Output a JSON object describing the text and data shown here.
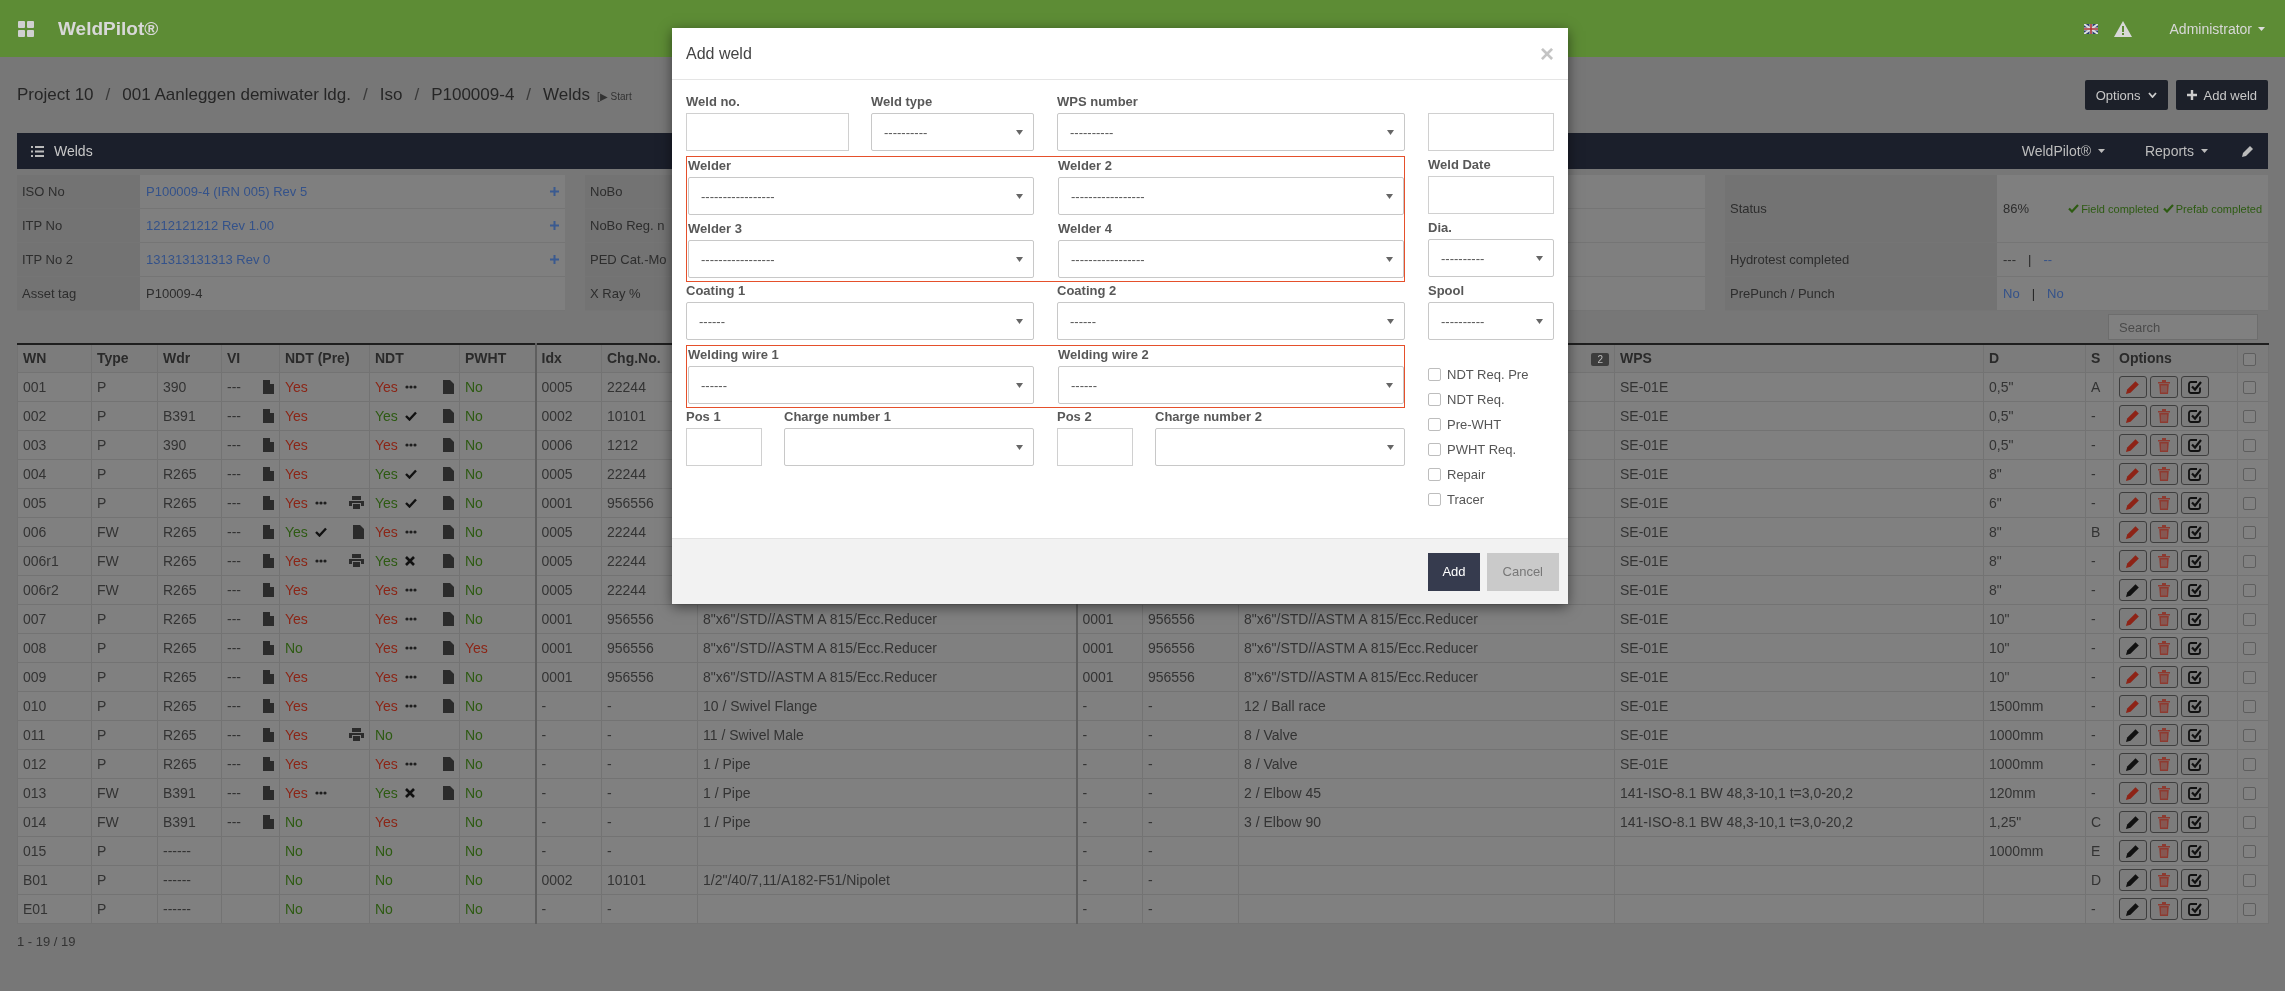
{
  "app": {
    "title": "WeldPilot®",
    "user": "Administrator"
  },
  "breadcrumb": [
    {
      "label": "Project 10"
    },
    {
      "separator": "/",
      "label": "001 Aanleggen demiwater ldg."
    },
    {
      "separator": "/",
      "label": "Iso"
    },
    {
      "separator": "/",
      "label": "P100009-4"
    },
    {
      "separator": "/",
      "label": "Welds"
    }
  ],
  "start_link": "[▶ Start",
  "header_buttons": [
    {
      "label": "Options",
      "kind": "dropdown"
    },
    {
      "label": "Add weld",
      "kind": "add"
    }
  ],
  "panel": {
    "title": "Welds",
    "menus": [
      "WeldPilot®",
      "Reports"
    ]
  },
  "info_left": [
    {
      "label": "ISO No",
      "value": "P100009-4 (IRN 005) Rev 5",
      "link": true,
      "addable": true
    },
    {
      "label": "ITP No",
      "value": "1212121212 Rev 1.00",
      "link": true,
      "addable": true
    },
    {
      "label": "ITP No 2",
      "value": "131313131313 Rev 0",
      "link": true,
      "addable": true
    },
    {
      "label": "Asset tag",
      "value": "P10009-4",
      "link": false,
      "addable": false
    }
  ],
  "info_middle": [
    {
      "label": "NoBo"
    },
    {
      "label": "NoBo Reg. n"
    },
    {
      "label": "PED Cat.-Mo"
    },
    {
      "label": "X Ray %"
    }
  ],
  "status": {
    "label": "Status",
    "value": "86%",
    "badges": [
      {
        "label": "Field completed"
      },
      {
        "label": "Prefab completed"
      }
    ]
  },
  "hydrotest": {
    "label": "Hydrotest completed",
    "value": "---",
    "separator": "|",
    "link": "--"
  },
  "punch": {
    "label": "PrePunch / Punch",
    "prepunch": "No",
    "separator": "|",
    "punch": "No"
  },
  "search": {
    "placeholder": "Search"
  },
  "table": {
    "columns": [
      "WN",
      "Type",
      "Wdr",
      "VI",
      "NDT (Pre)",
      "NDT",
      "PWHT",
      "Idx",
      "Chg.No.",
      "WPS",
      "D",
      "S",
      "Options"
    ],
    "badge": "2",
    "select_all": {
      "checked": false
    },
    "rows": [
      {
        "wn": "001",
        "type": "P",
        "wdr": "390",
        "vi": {
          "text": "---",
          "report": true
        },
        "ndt_pre": {
          "text": "Yes",
          "ok": false
        },
        "ndt": {
          "text": "Yes",
          "ok": false,
          "kind": "pending",
          "report": true
        },
        "pwht": {
          "text": "No",
          "ok": true
        },
        "idx": "0005",
        "chg": "22244",
        "wps": "SE-01E",
        "d": "0,5\"",
        "s": "A",
        "edit_flagged": true,
        "checked": false
      },
      {
        "wn": "002",
        "type": "P",
        "wdr": "B391",
        "vi": {
          "text": "---",
          "report": true
        },
        "ndt_pre": {
          "text": "Yes",
          "ok": false
        },
        "ndt": {
          "text": "Yes",
          "ok": true,
          "kind": "accepted",
          "report": true
        },
        "pwht": {
          "text": "No",
          "ok": true
        },
        "idx": "0002",
        "chg": "10101",
        "wps": "SE-01E",
        "d": "0,5\"",
        "s": "-",
        "edit_flagged": true,
        "checked": false
      },
      {
        "wn": "003",
        "type": "P",
        "wdr": "390",
        "vi": {
          "text": "---",
          "report": true
        },
        "ndt_pre": {
          "text": "Yes",
          "ok": false
        },
        "ndt": {
          "text": "Yes",
          "ok": false,
          "kind": "pending",
          "report": true
        },
        "pwht": {
          "text": "No",
          "ok": true
        },
        "idx": "0006",
        "chg": "1212",
        "wps": "SE-01E",
        "d": "0,5\"",
        "s": "-",
        "edit_flagged": true,
        "checked": false
      },
      {
        "wn": "004",
        "type": "P",
        "wdr": "R265",
        "vi": {
          "text": "---",
          "report": true
        },
        "ndt_pre": {
          "text": "Yes",
          "ok": false
        },
        "ndt": {
          "text": "Yes",
          "ok": true,
          "kind": "accepted",
          "report": true
        },
        "pwht": {
          "text": "No",
          "ok": true
        },
        "idx": "0005",
        "chg": "22244",
        "wps": "SE-01E",
        "d": "8\"",
        "s": "-",
        "edit_flagged": true,
        "checked": false
      },
      {
        "wn": "005",
        "type": "P",
        "wdr": "R265",
        "vi": {
          "text": "---",
          "report": true
        },
        "ndt_pre": {
          "text": "Yes",
          "ok": false,
          "kind": "pending",
          "printable": true
        },
        "ndt": {
          "text": "Yes",
          "ok": true,
          "kind": "accepted",
          "report": true
        },
        "pwht": {
          "text": "No",
          "ok": true
        },
        "idx": "0001",
        "chg": "956556",
        "wps": "SE-01E",
        "d": "6\"",
        "s": "-",
        "edit_flagged": true,
        "checked": false
      },
      {
        "wn": "006",
        "type": "FW",
        "wdr": "R265",
        "vi": {
          "text": "---",
          "report": true
        },
        "ndt_pre": {
          "text": "Yes",
          "ok": true,
          "kind": "accepted",
          "report": true
        },
        "ndt": {
          "text": "Yes",
          "ok": false,
          "kind": "pending",
          "report": true
        },
        "pwht": {
          "text": "No",
          "ok": true
        },
        "idx": "0005",
        "chg": "22244",
        "wps": "SE-01E",
        "d": "8\"",
        "s": "B",
        "edit_flagged": true,
        "checked": false
      },
      {
        "wn": "006r1",
        "type": "FW",
        "wdr": "R265",
        "vi": {
          "text": "---",
          "report": true
        },
        "ndt_pre": {
          "text": "Yes",
          "ok": false,
          "kind": "pending",
          "printable": true
        },
        "ndt": {
          "text": "Yes",
          "ok": true,
          "kind": "rejected",
          "report": true
        },
        "pwht": {
          "text": "No",
          "ok": true
        },
        "idx": "0005",
        "chg": "22244",
        "wps": "SE-01E",
        "d": "8\"",
        "s": "-",
        "edit_flagged": true,
        "checked": false
      },
      {
        "wn": "006r2",
        "type": "FW",
        "wdr": "R265",
        "vi": {
          "text": "---",
          "report": true
        },
        "ndt_pre": {
          "text": "Yes",
          "ok": false
        },
        "ndt": {
          "text": "Yes",
          "ok": false,
          "kind": "pending",
          "report": true
        },
        "pwht": {
          "text": "No",
          "ok": true
        },
        "idx": "0005",
        "chg": "22244",
        "wps": "SE-01E",
        "d": "8\"",
        "s": "-",
        "edit_flagged": false,
        "checked": false
      },
      {
        "wn": "007",
        "type": "P",
        "wdr": "R265",
        "vi": {
          "text": "---",
          "report": true
        },
        "ndt_pre": {
          "text": "Yes",
          "ok": false
        },
        "ndt": {
          "text": "Yes",
          "ok": false,
          "kind": "pending",
          "report": true
        },
        "pwht": {
          "text": "No",
          "ok": true
        },
        "idx": "0001",
        "chg": "956556",
        "desc": "8\"x6\"/STD//ASTM A 815/Ecc.Reducer",
        "idx2": "0001",
        "chg2": "956556",
        "desc2": "8\"x6\"/STD//ASTM A 815/Ecc.Reducer",
        "wps": "SE-01E",
        "d": "10\"",
        "s": "-",
        "edit_flagged": true,
        "checked": false
      },
      {
        "wn": "008",
        "type": "P",
        "wdr": "R265",
        "vi": {
          "text": "---",
          "report": true
        },
        "ndt_pre": {
          "text": "No",
          "ok": true
        },
        "ndt": {
          "text": "Yes",
          "ok": false,
          "kind": "pending",
          "report": true
        },
        "pwht": {
          "text": "Yes",
          "ok": false
        },
        "idx": "0001",
        "chg": "956556",
        "desc": "8\"x6\"/STD//ASTM A 815/Ecc.Reducer",
        "idx2": "0001",
        "chg2": "956556",
        "desc2": "8\"x6\"/STD//ASTM A 815/Ecc.Reducer",
        "wps": "SE-01E",
        "d": "10\"",
        "s": "-",
        "edit_flagged": false,
        "checked": false
      },
      {
        "wn": "009",
        "type": "P",
        "wdr": "R265",
        "vi": {
          "text": "---",
          "report": true
        },
        "ndt_pre": {
          "text": "Yes",
          "ok": false
        },
        "ndt": {
          "text": "Yes",
          "ok": false,
          "kind": "pending",
          "report": true
        },
        "pwht": {
          "text": "No",
          "ok": true
        },
        "idx": "0001",
        "chg": "956556",
        "desc": "8\"x6\"/STD//ASTM A 815/Ecc.Reducer",
        "idx2": "0001",
        "chg2": "956556",
        "desc2": "8\"x6\"/STD//ASTM A 815/Ecc.Reducer",
        "wps": "SE-01E",
        "d": "10\"",
        "s": "-",
        "edit_flagged": true,
        "checked": false
      },
      {
        "wn": "010",
        "type": "P",
        "wdr": "R265",
        "vi": {
          "text": "---",
          "report": true
        },
        "ndt_pre": {
          "text": "Yes",
          "ok": false
        },
        "ndt": {
          "text": "Yes",
          "ok": false,
          "kind": "pending",
          "report": true
        },
        "pwht": {
          "text": "No",
          "ok": true
        },
        "idx": "-",
        "chg": "-",
        "desc": "10 / Swivel Flange",
        "idx2": "-",
        "chg2": "-",
        "desc2": "12 / Ball race",
        "wps": "SE-01E",
        "d": "1500mm",
        "s": "-",
        "edit_flagged": true,
        "checked": false
      },
      {
        "wn": "011",
        "type": "P",
        "wdr": "R265",
        "vi": {
          "text": "---",
          "report": true
        },
        "ndt_pre": {
          "text": "Yes",
          "ok": false,
          "printable": true
        },
        "ndt": {
          "text": "No",
          "ok": true
        },
        "pwht": {
          "text": "No",
          "ok": true
        },
        "idx": "-",
        "chg": "-",
        "desc": "11 / Swivel Male",
        "idx2": "-",
        "chg2": "-",
        "desc2": "8 / Valve",
        "wps": "SE-01E",
        "d": "1000mm",
        "s": "-",
        "edit_flagged": false,
        "checked": false
      },
      {
        "wn": "012",
        "type": "P",
        "wdr": "R265",
        "vi": {
          "text": "---",
          "report": true
        },
        "ndt_pre": {
          "text": "Yes",
          "ok": false
        },
        "ndt": {
          "text": "Yes",
          "ok": false,
          "kind": "pending",
          "report": true
        },
        "pwht": {
          "text": "No",
          "ok": true
        },
        "idx": "-",
        "chg": "-",
        "desc": "1 / Pipe",
        "idx2": "-",
        "chg2": "-",
        "desc2": "8 / Valve",
        "wps": "SE-01E",
        "d": "1000mm",
        "s": "-",
        "edit_flagged": false,
        "checked": false
      },
      {
        "wn": "013",
        "type": "FW",
        "wdr": "B391",
        "vi": {
          "text": "---",
          "report": true
        },
        "ndt_pre": {
          "text": "Yes",
          "ok": false,
          "kind": "pending"
        },
        "ndt": {
          "text": "Yes",
          "ok": true,
          "kind": "rejected",
          "report": true
        },
        "pwht": {
          "text": "No",
          "ok": true
        },
        "idx": "-",
        "chg": "-",
        "desc": "1 / Pipe",
        "idx2": "-",
        "chg2": "-",
        "desc2": "2 / Elbow 45",
        "wps": "141-ISO-8.1 BW 48,3-10,1 t=3,0-20,2",
        "d": "120mm",
        "s": "-",
        "edit_flagged": true,
        "checked": false
      },
      {
        "wn": "014",
        "type": "FW",
        "wdr": "B391",
        "vi": {
          "text": "---",
          "report": true
        },
        "ndt_pre": {
          "text": "No",
          "ok": true
        },
        "ndt": {
          "text": "Yes",
          "ok": false
        },
        "pwht": {
          "text": "No",
          "ok": true
        },
        "idx": "-",
        "chg": "-",
        "desc": "1 / Pipe",
        "idx2": "-",
        "chg2": "-",
        "desc2": "3 / Elbow 90",
        "wps": "141-ISO-8.1 BW 48,3-10,1 t=3,0-20,2",
        "d": "1,25\"",
        "s": "C",
        "edit_flagged": false,
        "checked": false
      },
      {
        "wn": "015",
        "type": "P",
        "wdr": "------",
        "ndt_pre": {
          "text": "No",
          "ok": true
        },
        "ndt": {
          "text": "No",
          "ok": true
        },
        "pwht": {
          "text": "No",
          "ok": true
        },
        "idx": "-",
        "chg": "-",
        "idx2": "-",
        "chg2": "-",
        "d": "1000mm",
        "s": "E",
        "edit_flagged": false,
        "checked": false
      },
      {
        "wn": "B01",
        "type": "P",
        "wdr": "------",
        "ndt_pre": {
          "text": "No",
          "ok": true
        },
        "ndt": {
          "text": "No",
          "ok": true
        },
        "pwht": {
          "text": "No",
          "ok": true
        },
        "idx": "0002",
        "chg": "10101",
        "desc": "1/2\"/40/7,11/A182-F51/Nipolet",
        "idx2": "-",
        "chg2": "-",
        "s": "D",
        "edit_flagged": false,
        "checked": false
      },
      {
        "wn": "E01",
        "type": "P",
        "wdr": "------",
        "ndt_pre": {
          "text": "No",
          "ok": true
        },
        "ndt": {
          "text": "No",
          "ok": true
        },
        "pwht": {
          "text": "No",
          "ok": true
        },
        "idx": "-",
        "chg": "-",
        "idx2": "-",
        "chg2": "-",
        "s": "-",
        "edit_flagged": false,
        "checked": false
      }
    ]
  },
  "pagination": "1 - 19 / 19",
  "modal": {
    "title": "Add weld",
    "close": "×",
    "weld_no": {
      "label": "Weld no."
    },
    "weld_type": {
      "label": "Weld type",
      "value": "----------"
    },
    "wps_number": {
      "label": "WPS number",
      "value": "----------"
    },
    "welders": {
      "highlighted": true,
      "fields": [
        {
          "label": "Welder",
          "value": "-----------------"
        },
        {
          "label": "Welder 2",
          "value": "-----------------"
        },
        {
          "label": "Welder 3",
          "value": "-----------------"
        },
        {
          "label": "Welder 4",
          "value": "-----------------"
        }
      ]
    },
    "coatings": [
      {
        "label": "Coating 1",
        "value": "------"
      },
      {
        "label": "Coating 2",
        "value": "------"
      }
    ],
    "welding_wires": {
      "highlighted": true,
      "fields": [
        {
          "label": "Welding wire 1",
          "value": "------"
        },
        {
          "label": "Welding wire 2",
          "value": "------"
        }
      ]
    },
    "positions": [
      {
        "pos_label": "Pos 1",
        "charge_label": "Charge number 1"
      },
      {
        "pos_label": "Pos 2",
        "charge_label": "Charge number 2"
      }
    ],
    "weld_date": {
      "label": "Weld Date"
    },
    "dia": {
      "label": "Dia.",
      "value": "----------"
    },
    "spool": {
      "label": "Spool",
      "value": "----------"
    },
    "options": [
      {
        "label": "NDT Req. Pre",
        "checked": false
      },
      {
        "label": "NDT Req.",
        "checked": false
      },
      {
        "label": "Pre-WHT",
        "checked": false
      },
      {
        "label": "PWHT Req.",
        "checked": false
      },
      {
        "label": "Repair",
        "checked": false
      },
      {
        "label": "Tracer",
        "checked": false
      }
    ],
    "buttons": [
      {
        "label": "Add",
        "kind": "primary"
      },
      {
        "label": "Cancel",
        "kind": "secondary"
      }
    ]
  }
}
